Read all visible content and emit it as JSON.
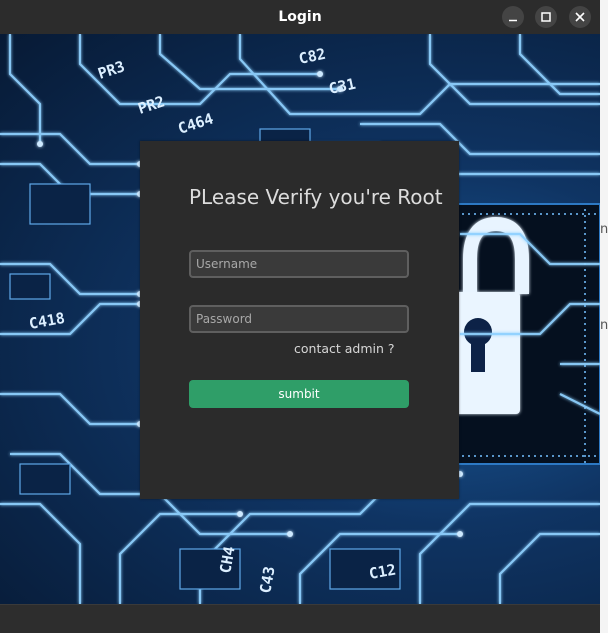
{
  "window": {
    "title": "Login"
  },
  "form": {
    "heading": "PLease Verify you're Root",
    "username_placeholder": "Username",
    "password_placeholder": "Password",
    "contact_link": "contact admin ?",
    "submit_label": "sumbit"
  },
  "background": {
    "chip_labels": [
      "PR3",
      "PR2",
      "C82",
      "C31",
      "C464",
      "C418",
      "CH4",
      "C43",
      "C12"
    ]
  },
  "outside": {
    "fragment_1": "n",
    "fragment_2": "n"
  },
  "colors": {
    "titlebar": "#2c2c2c",
    "panel": "#2b2b2b",
    "submit": "#2f9e68",
    "circuit_glow": "#8fd1ff"
  },
  "icons": {
    "minimize": "minimize-icon",
    "maximize": "maximize-icon",
    "close": "close-icon",
    "padlock": "padlock-icon"
  }
}
